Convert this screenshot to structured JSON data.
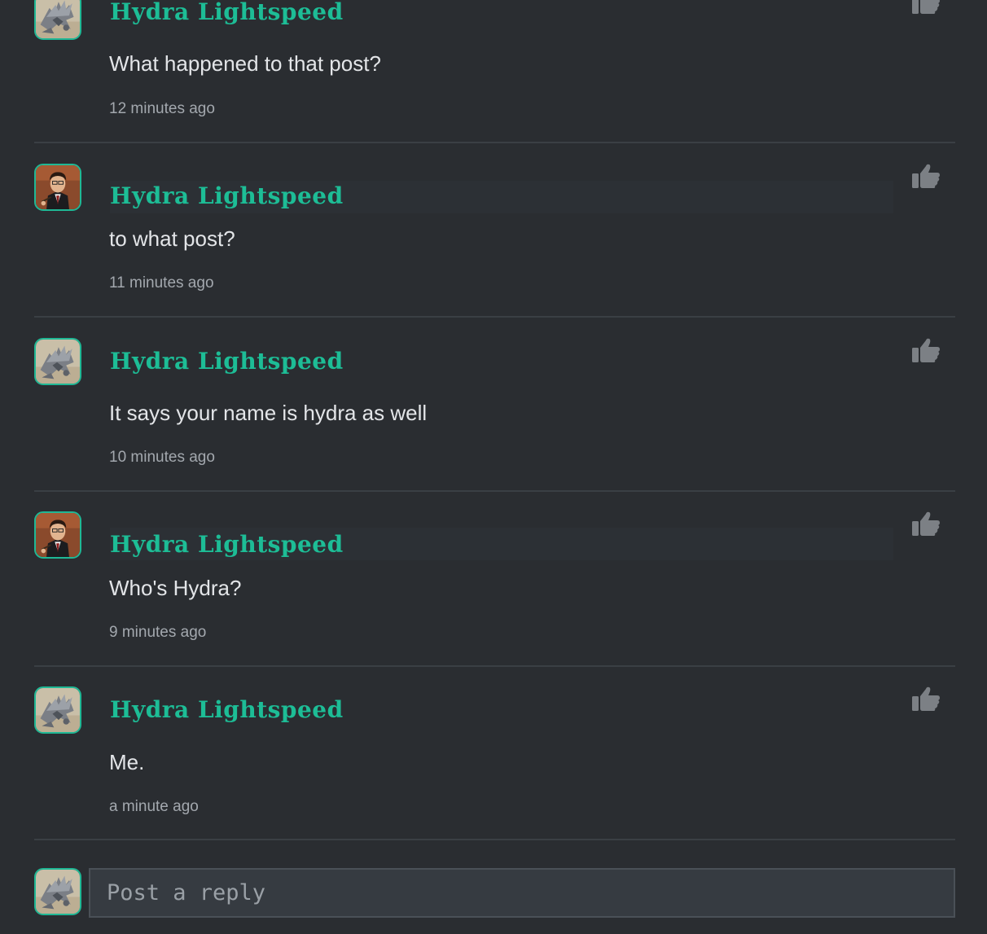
{
  "theme": {
    "background": "#2a2d31",
    "accent": "#1dbd96",
    "avatar_border": "#1fb895",
    "divider": "#3a3f44",
    "like_icon": "#7c8085"
  },
  "comments": [
    {
      "author": "Hydra Lightspeed",
      "avatar": "dragon-avatar",
      "text": "What happened to that post?",
      "time": "12 minutes ago",
      "like_icon": "thumbs-up-icon"
    },
    {
      "author": "Hydra Lightspeed",
      "avatar": "wizard-avatar",
      "text": "to what post?",
      "time": "11 minutes ago",
      "like_icon": "thumbs-up-icon"
    },
    {
      "author": "Hydra Lightspeed",
      "avatar": "dragon-avatar",
      "text": "It says your name is hydra as well",
      "time": "10 minutes ago",
      "like_icon": "thumbs-up-icon"
    },
    {
      "author": "Hydra Lightspeed",
      "avatar": "wizard-avatar",
      "text": "Who's Hydra?",
      "time": "9 minutes ago",
      "like_icon": "thumbs-up-icon"
    },
    {
      "author": "Hydra Lightspeed",
      "avatar": "dragon-avatar",
      "text": "Me.",
      "time": "a minute ago",
      "like_icon": "thumbs-up-icon"
    }
  ],
  "reply": {
    "avatar": "dragon-avatar",
    "placeholder": "Post a reply",
    "value": ""
  }
}
